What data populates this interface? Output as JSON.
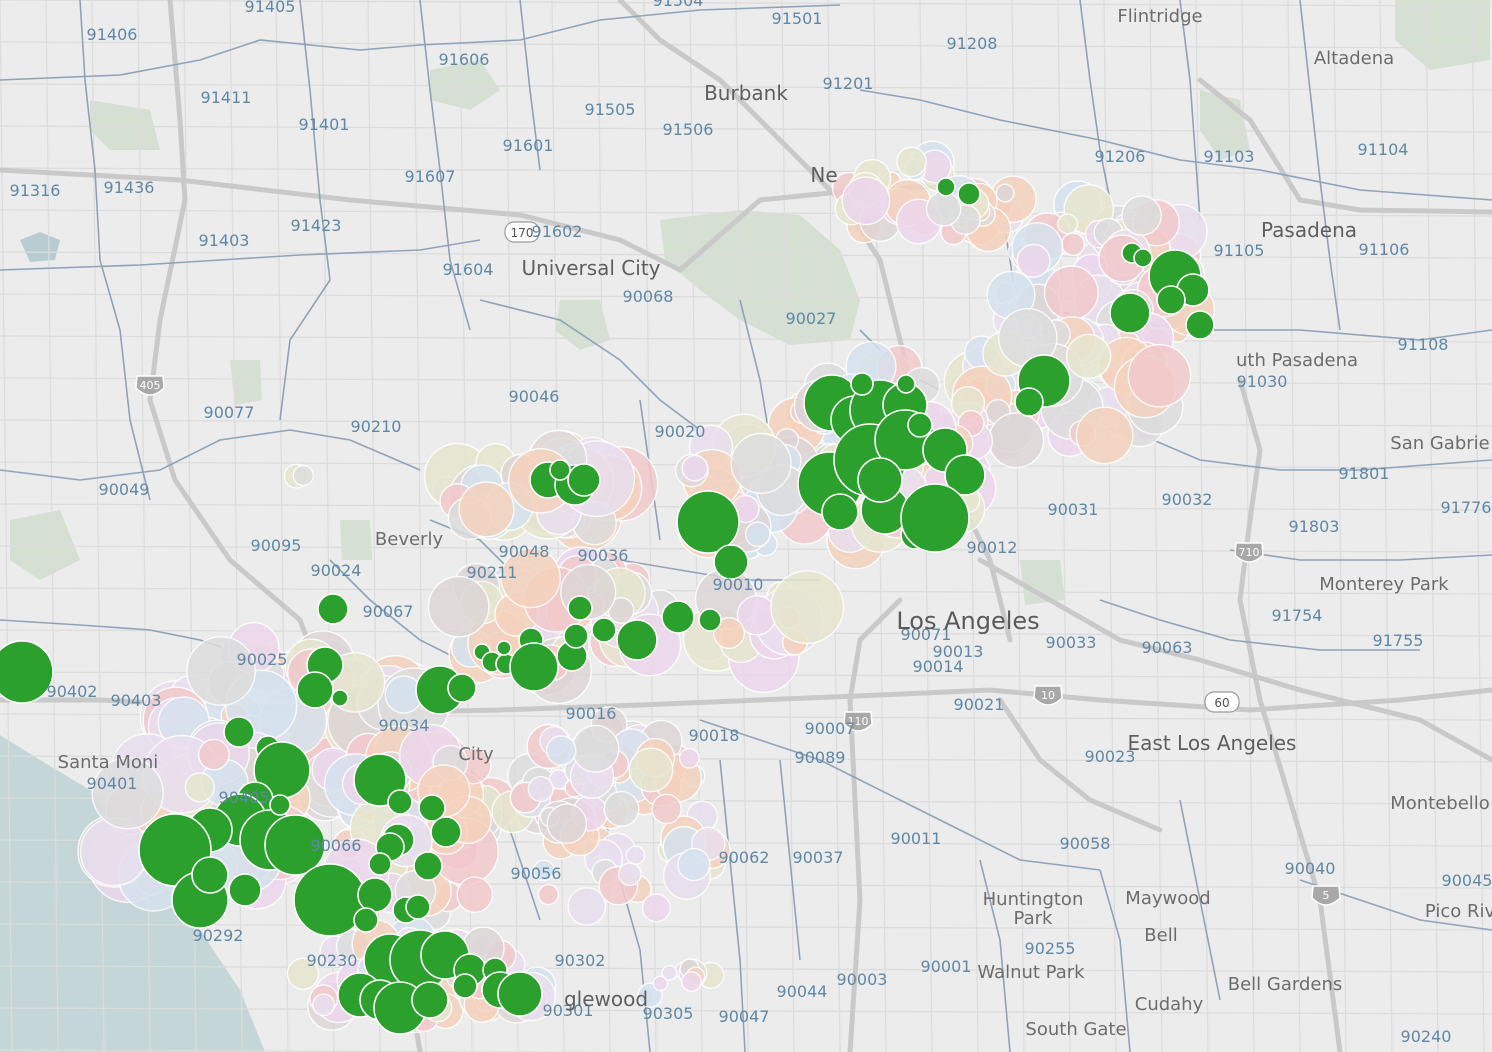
{
  "map": {
    "colors": {
      "land": "#ececec",
      "water": "#c5d6d8",
      "park": "#cfdccc",
      "zip_border": "#8fa3b8",
      "freeway": "#c9c9c9",
      "street": "#dcdcdc",
      "highlight": "#2ca02c",
      "pastel": [
        "#f5d2bd",
        "#d6e2ee",
        "#ecd7ec",
        "#ddd6d6",
        "#e6e6cf",
        "#dddddd",
        "#f2c9cc",
        "#e9dfef"
      ]
    },
    "city_labels": [
      {
        "text": "Flintridge",
        "style": "city"
      },
      {
        "text": "Altadena",
        "style": "city"
      },
      {
        "text": "Burbank",
        "style": "city-md"
      },
      {
        "text": "Pasadena",
        "style": "city-md"
      },
      {
        "text": "Universal City",
        "style": "city-md"
      },
      {
        "text": "uth Pasadena",
        "style": "city"
      },
      {
        "text": "San Gabrie",
        "style": "city"
      },
      {
        "text": "Monterey Park",
        "style": "city"
      },
      {
        "text": "Beverly",
        "style": "city"
      },
      {
        "text": "Los Angeles",
        "style": "city-lg"
      },
      {
        "text": "East Los Angeles",
        "style": "city-md"
      },
      {
        "text": "Montebello",
        "style": "city"
      },
      {
        "text": "Santa Moni",
        "style": "city"
      },
      {
        "text": "City",
        "style": "city"
      },
      {
        "text": "Huntington",
        "style": "city"
      },
      {
        "text": "Park",
        "style": "city"
      },
      {
        "text": "Maywood",
        "style": "city"
      },
      {
        "text": "Bell",
        "style": "city"
      },
      {
        "text": "Pico Riv",
        "style": "city"
      },
      {
        "text": "Walnut Park",
        "style": "city"
      },
      {
        "text": "Bell Gardens",
        "style": "city"
      },
      {
        "text": "Cudahy",
        "style": "city"
      },
      {
        "text": "South Gate",
        "style": "city"
      },
      {
        "text": "glewood",
        "style": "city-md"
      },
      {
        "text": "Ne",
        "style": "city-md"
      }
    ],
    "zip_labels": [
      "91405",
      "91504",
      "91501",
      "91208",
      "91406",
      "91606",
      "91201",
      "91411",
      "91505",
      "91401",
      "91506",
      "91601",
      "91316",
      "91436",
      "91607",
      "91206",
      "91103",
      "91104",
      "91423",
      "91602",
      "91403",
      "91604",
      "91105",
      "91106",
      "90068",
      "90027",
      "91108",
      "91030",
      "90077",
      "90046",
      "90210",
      "90049",
      "91801",
      "91776",
      "90095",
      "90048",
      "90036",
      "90020",
      "90010",
      "90012",
      "90031",
      "90032",
      "91803",
      "90024",
      "90211",
      "90071",
      "90013",
      "90014",
      "91754",
      "91755",
      "90067",
      "90033",
      "90063",
      "90025",
      "90402",
      "90403",
      "90034",
      "90016",
      "90021",
      "90018",
      "90007",
      "90089",
      "90023",
      "90401",
      "90011",
      "90058",
      "90062",
      "90037",
      "90040",
      "90292",
      "90056",
      "90255",
      "90001",
      "90302",
      "90044",
      "90003",
      "90305",
      "90047",
      "90240",
      "90301",
      "90405",
      "90066",
      "90230",
      "90045"
    ],
    "highway_shields": [
      "405",
      "170",
      "110",
      "10",
      "60",
      "710",
      "5"
    ],
    "legend_note": ""
  }
}
